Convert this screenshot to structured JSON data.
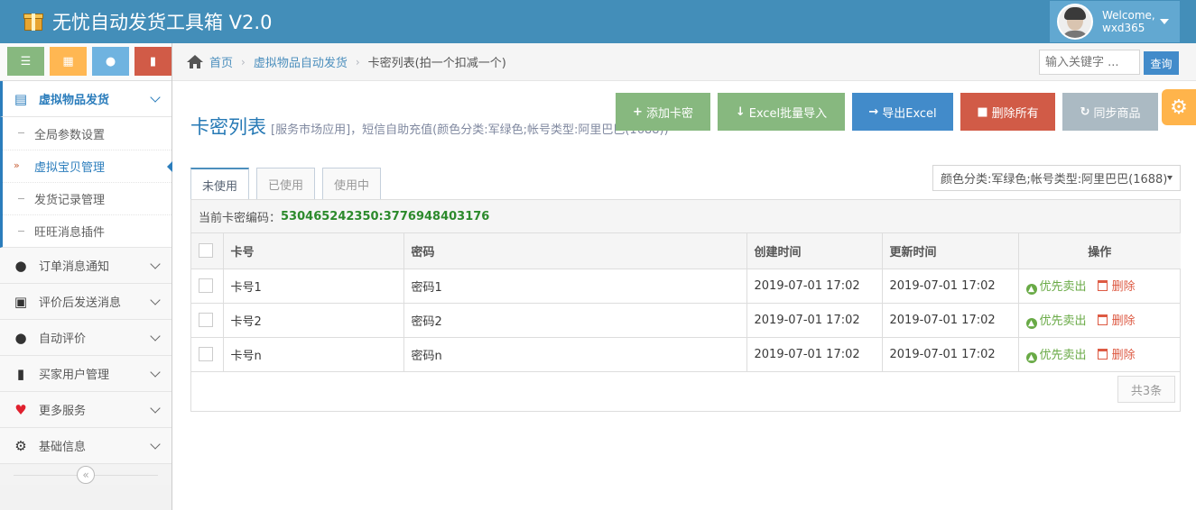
{
  "app": {
    "title": "无忧自动发货工具箱 V2.0",
    "welcome": "Welcome,",
    "username": "wxd365"
  },
  "sidebar": {
    "shortcuts": [
      {
        "icon": "list-icon",
        "color": "#87b87f"
      },
      {
        "icon": "calendar-icon",
        "color": "#ffb752"
      },
      {
        "icon": "comment-icon",
        "color": "#6fb3e0"
      },
      {
        "icon": "book-icon",
        "color": "#d15b47"
      }
    ],
    "menu_open": {
      "label": "虚拟物品发货",
      "icon": "credit-card-icon",
      "children": [
        {
          "label": "全局参数设置",
          "active": false
        },
        {
          "label": "虚拟宝贝管理",
          "active": true
        },
        {
          "label": "发货记录管理",
          "active": false
        },
        {
          "label": "旺旺消息插件",
          "active": false
        }
      ]
    },
    "menu": [
      {
        "label": "订单消息通知",
        "icon": "comment-icon"
      },
      {
        "label": "评价后发送消息",
        "icon": "gift-icon"
      },
      {
        "label": "自动评价",
        "icon": "comment-icon"
      },
      {
        "label": "买家用户管理",
        "icon": "book-icon"
      },
      {
        "label": "更多服务",
        "icon": "heart-icon"
      },
      {
        "label": "基础信息",
        "icon": "cog-icon"
      }
    ]
  },
  "breadcrumb": {
    "home": "首页",
    "level1": "虚拟物品自动发货",
    "current": "卡密列表(拍一个扣减一个)"
  },
  "search": {
    "placeholder": "输入关键字 ...",
    "button": "查询"
  },
  "page": {
    "title": "卡密列表",
    "subtitle": "[服务市场应用]，短信自助充值(颜色分类:军绿色;帐号类型:阿里巴巴(1688))"
  },
  "toolbar": {
    "add": "添加卡密",
    "import": "Excel批量导入",
    "export": "导出Excel",
    "delete_all": "删除所有",
    "sync": "同步商品"
  },
  "tabs": [
    "未使用",
    "已使用",
    "使用中"
  ],
  "filter": {
    "selected": "颜色分类:军绿色;帐号类型:阿里巴巴(1688)"
  },
  "card_code": {
    "label": "当前卡密编码：",
    "value": "530465242350:3776948403176"
  },
  "table": {
    "columns": [
      "卡号",
      "密码",
      "创建时间",
      "更新时间",
      "操作"
    ],
    "rows": [
      {
        "card": "卡号1",
        "password": "密码1",
        "created": "2019-07-01 17:02",
        "updated": "2019-07-01 17:02"
      },
      {
        "card": "卡号2",
        "password": "密码2",
        "created": "2019-07-01 17:02",
        "updated": "2019-07-01 17:02"
      },
      {
        "card": "卡号n",
        "password": "密码n",
        "created": "2019-07-01 17:02",
        "updated": "2019-07-01 17:02"
      }
    ],
    "action_sell": "优先卖出",
    "action_delete": "删除"
  },
  "pagination": {
    "total": "共3条"
  },
  "colors": {
    "navbar": "#438eb9",
    "primary": "#428bca",
    "success": "#87b87f",
    "danger": "#d15b47",
    "grey": "#abbac3",
    "warning": "#ffb44b"
  }
}
